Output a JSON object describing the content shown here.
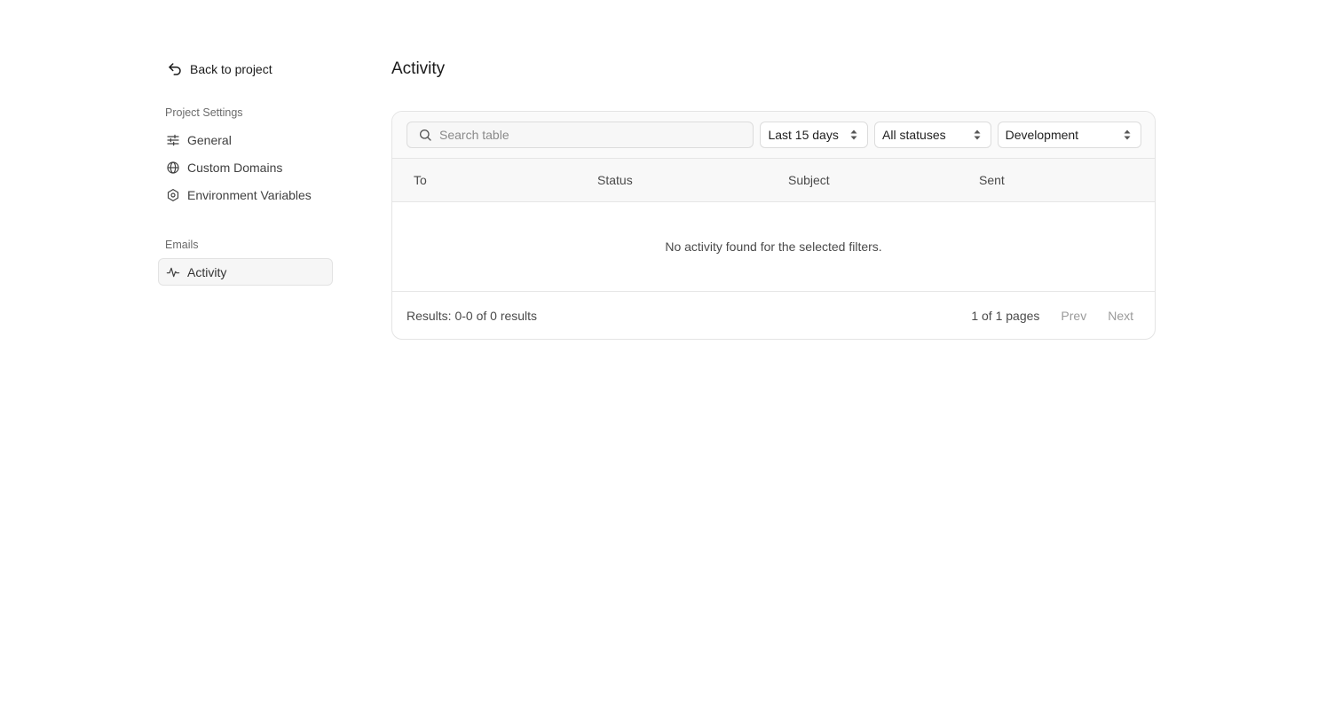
{
  "sidebar": {
    "back_label": "Back to project",
    "sections": [
      {
        "title": "Project Settings",
        "items": [
          {
            "label": "General",
            "icon": "sliders-icon"
          },
          {
            "label": "Custom Domains",
            "icon": "globe-icon"
          },
          {
            "label": "Environment Variables",
            "icon": "settings-hex-icon"
          }
        ]
      },
      {
        "title": "Emails",
        "items": [
          {
            "label": "Activity",
            "icon": "activity-pulse-icon",
            "active": true
          }
        ]
      }
    ]
  },
  "main": {
    "title": "Activity",
    "filters": {
      "search_placeholder": "Search table",
      "date_range": "Last 15 days",
      "status": "All statuses",
      "environment": "Development"
    },
    "table": {
      "columns": [
        "To",
        "Status",
        "Subject",
        "Sent"
      ],
      "rows": [],
      "empty_message": "No activity found for the selected filters."
    },
    "footer": {
      "results": "Results: 0-0 of 0 results",
      "page_info": "1 of 1 pages",
      "prev_label": "Prev",
      "next_label": "Next"
    }
  }
}
